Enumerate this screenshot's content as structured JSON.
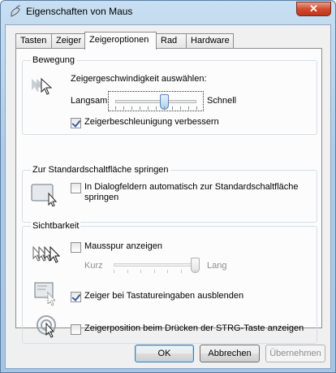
{
  "window": {
    "title": "Eigenschaften von Maus",
    "close_label": "✕"
  },
  "tabs": [
    {
      "label": "Tasten"
    },
    {
      "label": "Zeiger"
    },
    {
      "label": "Zeigeroptionen"
    },
    {
      "label": "Rad"
    },
    {
      "label": "Hardware"
    }
  ],
  "active_tab": "Zeigeroptionen",
  "motion": {
    "title": "Bewegung",
    "speed_label": "Zeigergeschwindigkeit auswählen:",
    "slow_label": "Langsam",
    "fast_label": "Schnell",
    "speed_value": 0.6,
    "enhance_label": "Zeigerbeschleunigung verbessern",
    "enhance_checked": true
  },
  "snap": {
    "title": "Zur Standardschaltfläche springen",
    "label": "In Dialogfeldern automatisch zur Standardschaltfläche springen",
    "checked": false
  },
  "visibility": {
    "title": "Sichtbarkeit",
    "trails_label": "Mausspur anzeigen",
    "trails_checked": false,
    "short_label": "Kurz",
    "long_label": "Lang",
    "trails_value": 1.0,
    "hide_label": "Zeiger bei Tastatureingaben ausblenden",
    "hide_checked": true,
    "ctrl_label": "Zeigerposition beim Drücken der STRG-Taste anzeigen",
    "ctrl_checked": false
  },
  "buttons": {
    "ok": "OK",
    "cancel": "Abbrechen",
    "apply": "Übernehmen"
  }
}
